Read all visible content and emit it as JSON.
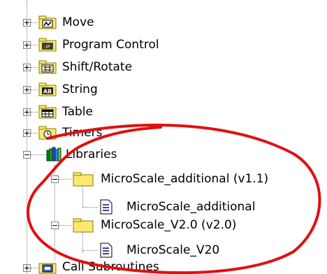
{
  "tree": {
    "items": [
      {
        "label": "Move",
        "icon": "folder-move-icon",
        "expanded": false
      },
      {
        "label": "Program Control",
        "icon": "folder-program-control-icon",
        "expanded": false
      },
      {
        "label": "Shift/Rotate",
        "icon": "folder-shift-rotate-icon",
        "expanded": false
      },
      {
        "label": "String",
        "icon": "folder-string-icon",
        "badge": "AB",
        "expanded": false
      },
      {
        "label": "Table",
        "icon": "folder-table-icon",
        "expanded": false
      },
      {
        "label": "Timers",
        "icon": "folder-timers-icon",
        "expanded": false
      },
      {
        "label": "Libraries",
        "icon": "libraries-books-icon",
        "expanded": true
      },
      {
        "label": "MicroScale_additional (v1.1)",
        "icon": "folder-icon",
        "expanded": true
      },
      {
        "label": "MicroScale_additional",
        "icon": "document-icon"
      },
      {
        "label": "MicroScale_V2.0 (v2.0)",
        "icon": "folder-icon",
        "expanded": true
      },
      {
        "label": "MicroScale_V20",
        "icon": "document-icon"
      },
      {
        "label": "Call Subroutines",
        "icon": "call-subroutines-icon",
        "expanded": false
      }
    ]
  },
  "colors": {
    "annotation": "#e01010",
    "folder": "#ffe870",
    "folder_edge": "#808000"
  }
}
